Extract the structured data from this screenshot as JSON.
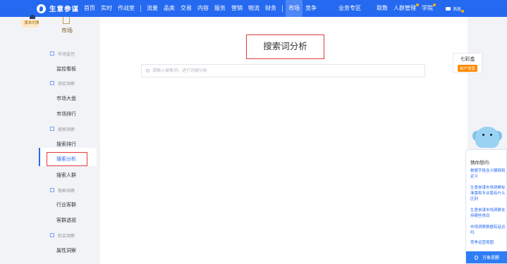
{
  "header": {
    "logo_text": "生意参谋",
    "nav_left": [
      "首页",
      "实时",
      "作战室"
    ],
    "nav_mid": [
      "流量",
      "品类",
      "交易",
      "内容",
      "服务",
      "营销",
      "物流",
      "财务"
    ],
    "nav_market": [
      "市场",
      "竞争"
    ],
    "nav_business": "业务专区",
    "nav_right": [
      "取数",
      "人群管理",
      "学院"
    ],
    "message_label": "消息",
    "active_item": "市场",
    "colors": {
      "bar": "#2469f0",
      "active": "#4d86f5",
      "badge": "#ffb300"
    }
  },
  "logo_badge": "版本切换",
  "sidebar": {
    "brand": "市场",
    "groups": [
      {
        "label": "市场监控",
        "items": [
          "监控看板"
        ]
      },
      {
        "label": "供给洞察",
        "items": [
          "市场大盘",
          "市场排行"
        ]
      },
      {
        "label": "搜索洞察",
        "items": [
          "搜索排行",
          "搜索分析",
          "搜索人群"
        ]
      },
      {
        "label": "客群洞察",
        "items": [
          "行业客群",
          "客群透视"
        ]
      },
      {
        "label": "机会洞察",
        "items": [
          "属性洞察"
        ]
      }
    ],
    "active_item": "搜索分析"
  },
  "main": {
    "title": "搜索词分析",
    "search_placeholder": "请输入搜索词，进行词搜分析"
  },
  "qicai": {
    "title": "七彩盒",
    "button": "用户信息"
  },
  "help_panel": {
    "title": "猜你想问:",
    "questions": [
      "数据字段含义解释和定义",
      "生意参谋市场洞察标准版和专业版有什么区别",
      "生意参谋市场洞察支持哪些类目",
      "市场洞察数据有延迟吗",
      "竞争运营视图"
    ],
    "footer": "万象提醒"
  }
}
